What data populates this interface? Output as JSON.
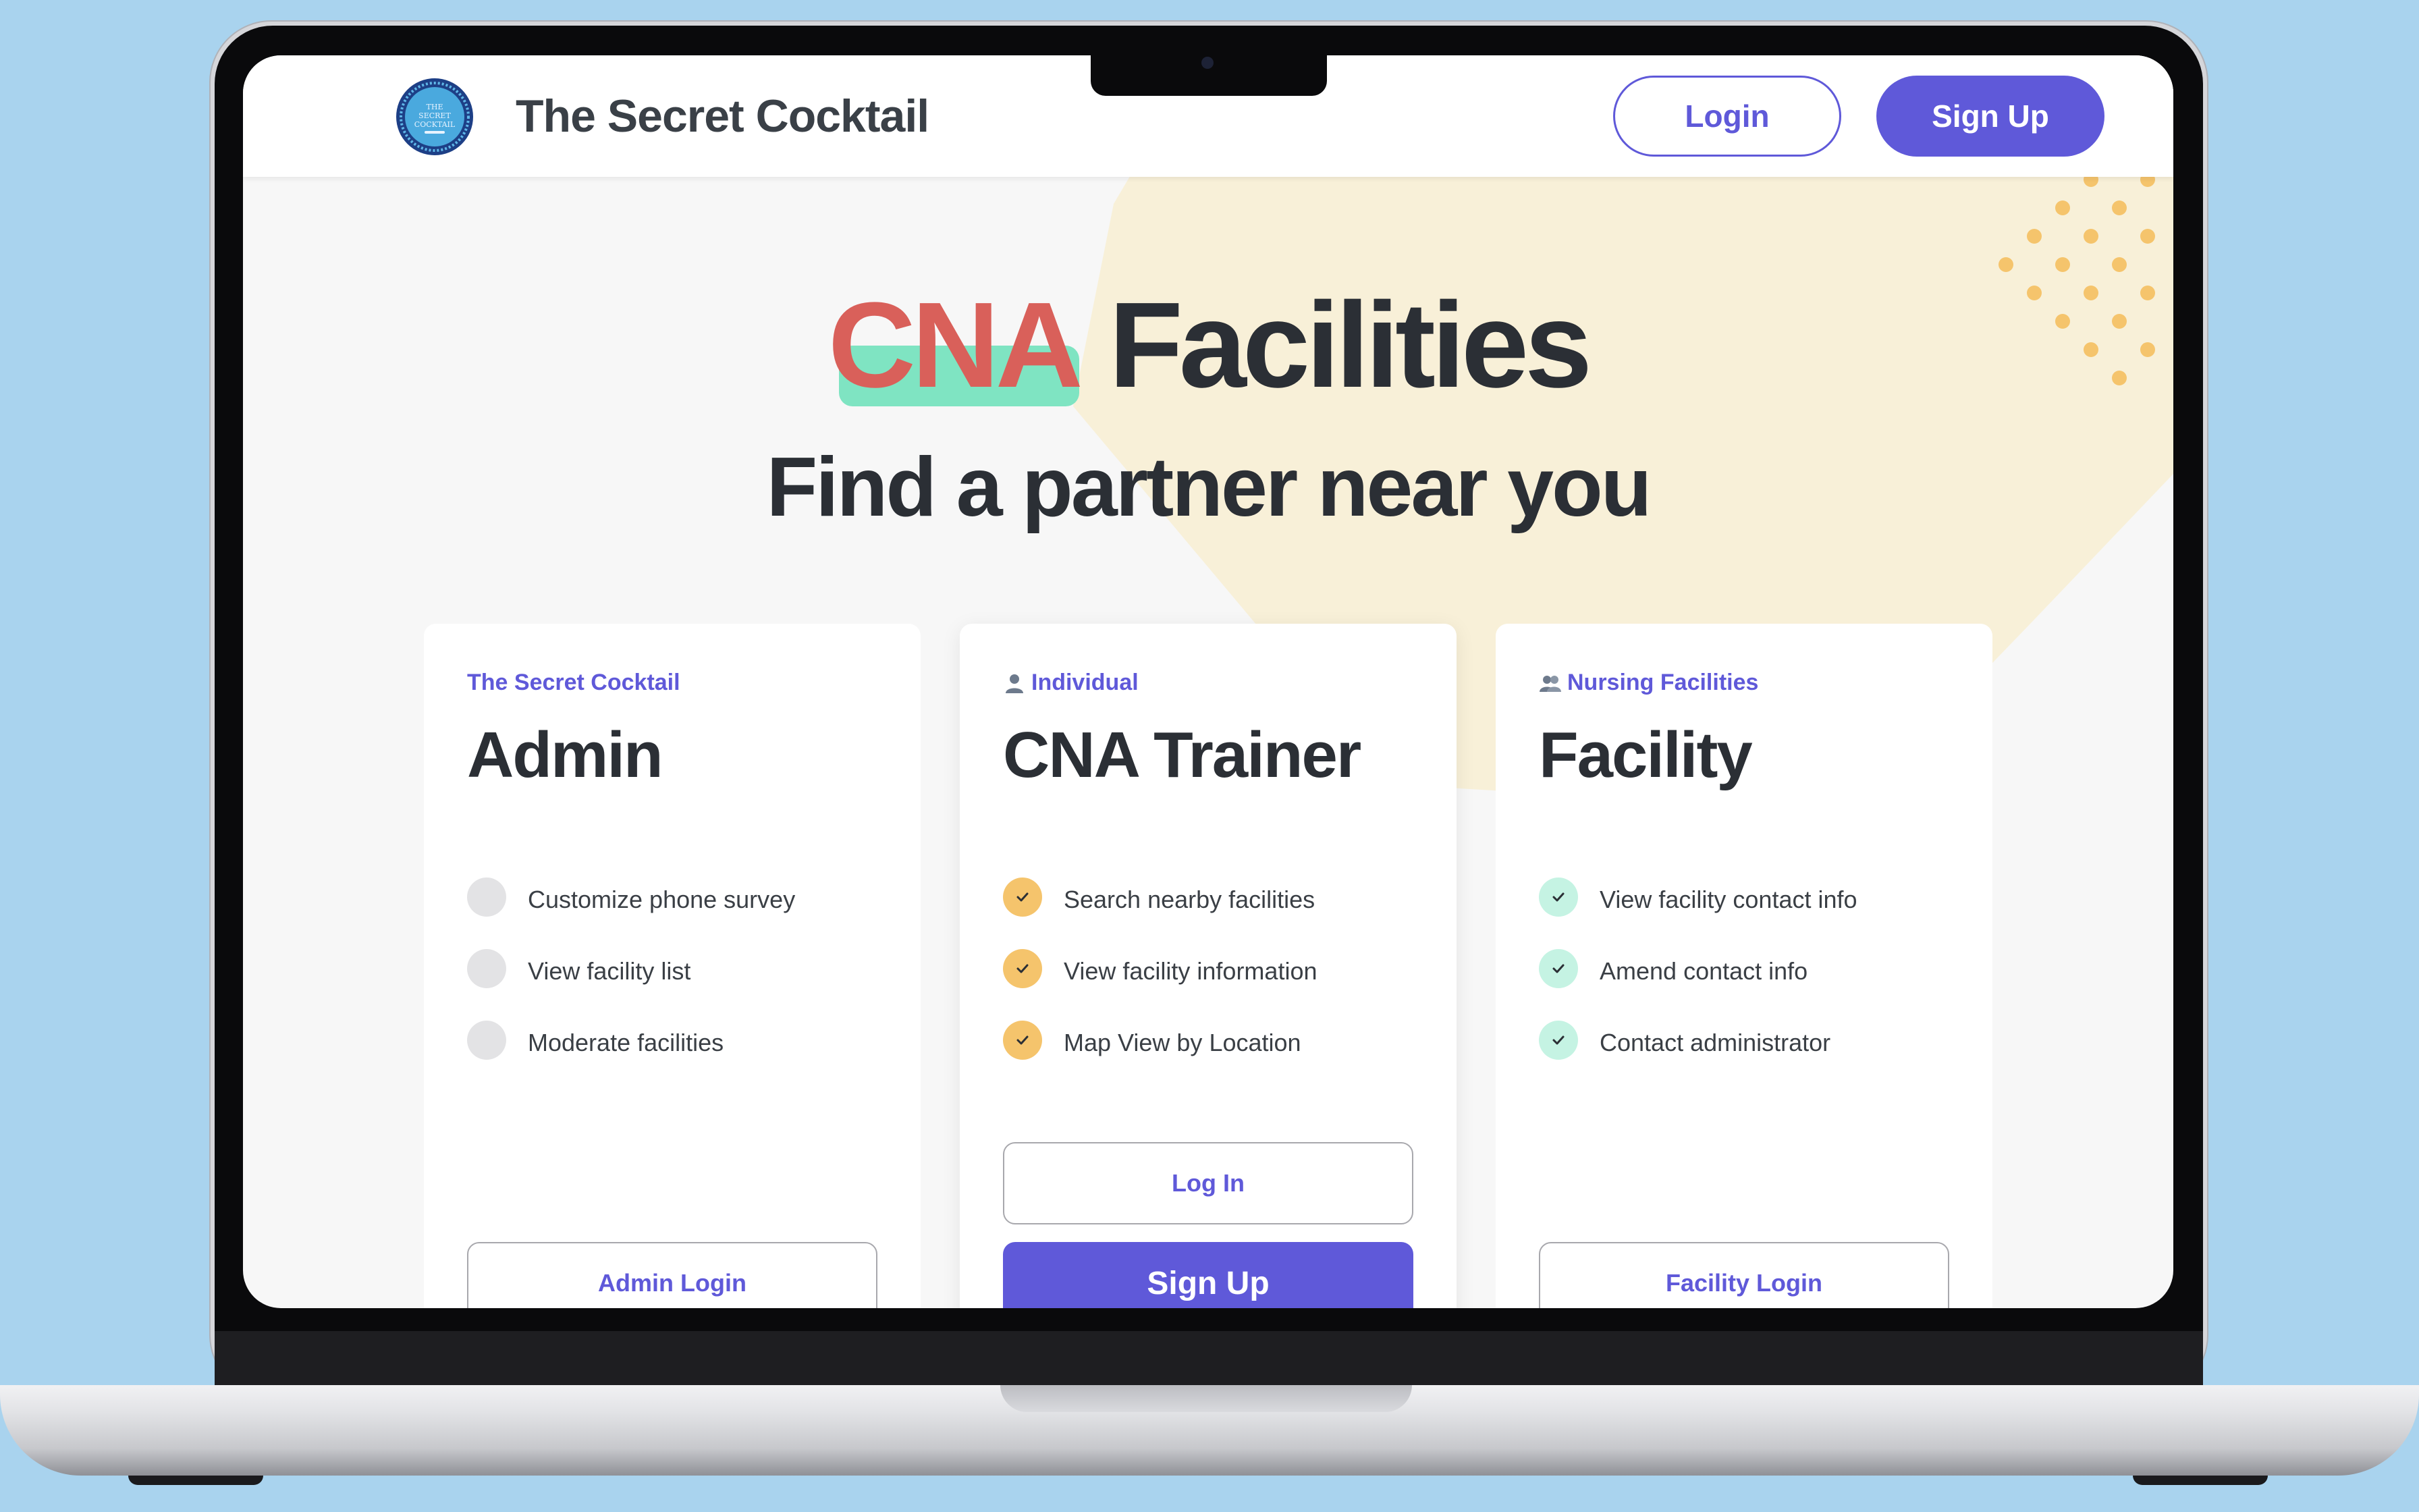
{
  "brand": {
    "name": "The Secret Cocktail",
    "logo_text_line1": "THE",
    "logo_text_line2": "SECRET",
    "logo_text_line3": "COCKTAIL"
  },
  "nav": {
    "login_label": "Login",
    "signup_label": "Sign Up"
  },
  "hero": {
    "title_accent": "CNA",
    "title_rest": "Facilities",
    "subtitle": "Find a partner near you"
  },
  "cards": [
    {
      "eyebrow": "The Secret Cocktail",
      "icon": "",
      "title": "Admin",
      "features": [
        "Customize phone survey",
        "View facility list",
        "Moderate facilities"
      ],
      "primary_button": "Admin Login"
    },
    {
      "eyebrow": "Individual",
      "icon": "person-icon",
      "title": "CNA Trainer",
      "features": [
        "Search nearby facilities",
        "View facility information",
        "Map View by Location"
      ],
      "secondary_button": "Log In",
      "primary_button": "Sign Up"
    },
    {
      "eyebrow": "Nursing Facilities",
      "icon": "people-icon",
      "title": "Facility",
      "features": [
        "View facility contact info",
        "Amend contact info",
        "Contact administrator"
      ],
      "primary_button": "Facility Login"
    }
  ],
  "colors": {
    "primary": "#5f59d9",
    "accent_red": "#d9605a",
    "highlight_mint": "#7fe4c2",
    "dot_yellow": "#f5c46c",
    "dot_mint": "#c5f3e3",
    "dot_gray": "#e3e3e5",
    "hero_shape": "#f8f0d8",
    "background": "#a9d3ee"
  }
}
